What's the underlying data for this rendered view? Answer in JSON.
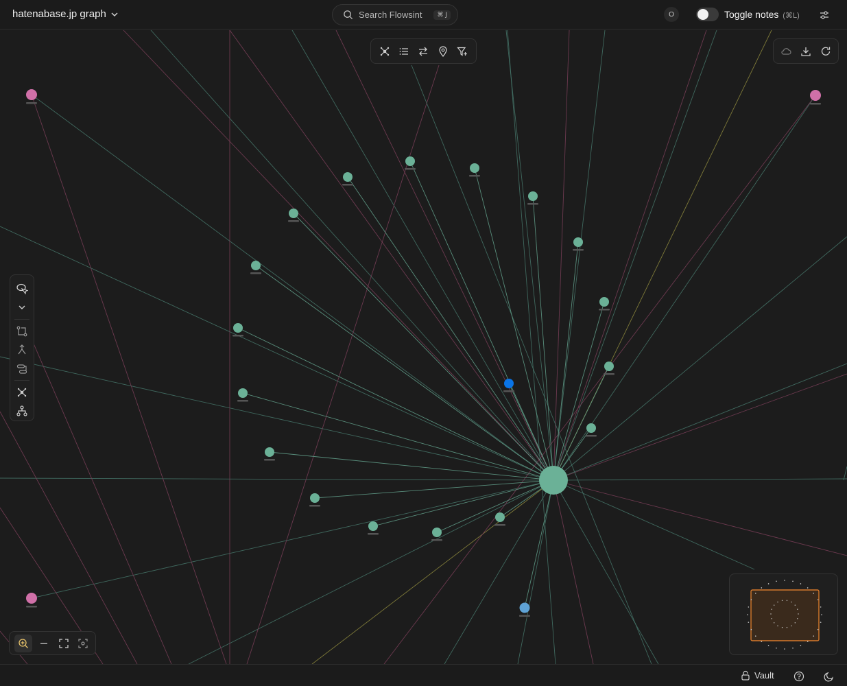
{
  "header": {
    "graph_title": "hatenabase.jp graph",
    "search_placeholder": "Search Flowsint",
    "search_shortcut": "⌘ J",
    "avatar_initial": "O",
    "toggle_notes_label": "Toggle notes",
    "toggle_notes_shortcut": "(⌘L)",
    "toggle_notes_on": false
  },
  "toolbar": {
    "center_icons": [
      "graph-layout-icon",
      "list-view-icon",
      "swap-arrows-icon",
      "map-pin-icon",
      "filter-plus-icon"
    ],
    "right_icons": [
      "cloud-icon",
      "download-icon",
      "refresh-icon"
    ],
    "left_icons": [
      "lasso-select-icon",
      "chevron-down-icon",
      "path-icon",
      "merge-icon",
      "routes-icon",
      "graph-layout-icon",
      "hierarchy-icon"
    ],
    "zoom_icons": [
      "zoom-in-icon",
      "zoom-out-icon",
      "fit-view-icon",
      "focus-icon"
    ]
  },
  "graph": {
    "node_colors": {
      "hub": "#6bb197",
      "domain": "#6bb197",
      "external": "#d070a8",
      "selected": "#0a74e6",
      "info": "#5fa3d6"
    },
    "edge_colors": {
      "teal": "#46766a",
      "pink": "#7a3f58",
      "yellow": "#8f8a3e"
    }
  },
  "footer": {
    "vault_label": "Vault",
    "icons": [
      "lock-icon",
      "help-icon",
      "moon-icon"
    ]
  },
  "colors": {
    "background": "#1c1c1c",
    "panel": "#1f1f1f",
    "border": "#333333",
    "minimap_view": "#d87a2c"
  }
}
